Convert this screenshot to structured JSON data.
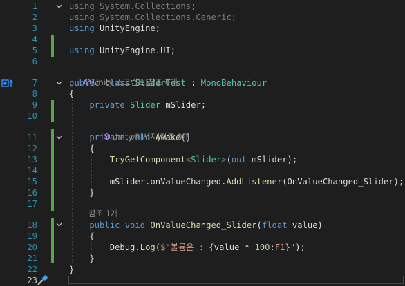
{
  "editor": {
    "lines": [
      {
        "n": "1",
        "tokens": [
          {
            "t": "using ",
            "c": "dim"
          },
          {
            "t": "System.Collections;",
            "c": "dim"
          }
        ]
      },
      {
        "n": "2",
        "tokens": [
          {
            "t": "using ",
            "c": "dim"
          },
          {
            "t": "System.Collections.Generic;",
            "c": "dim"
          }
        ]
      },
      {
        "n": "3",
        "tokens": [
          {
            "t": "using ",
            "c": "kw"
          },
          {
            "t": "UnityEngine;",
            "c": "pl"
          }
        ]
      },
      {
        "n": "4",
        "tokens": []
      },
      {
        "n": "5",
        "tokens": [
          {
            "t": "using ",
            "c": "kw"
          },
          {
            "t": "UnityEngine.UI;",
            "c": "pl"
          }
        ]
      },
      {
        "n": "6",
        "tokens": []
      },
      {
        "n": "7",
        "tokens": [
          {
            "t": "public ",
            "c": "kw"
          },
          {
            "t": "class ",
            "c": "kw"
          },
          {
            "t": "SliderTest",
            "c": "ty"
          },
          {
            "t": " : ",
            "c": "pl"
          },
          {
            "t": "MonoBehaviour",
            "c": "ty"
          }
        ]
      },
      {
        "n": "8",
        "tokens": [
          {
            "t": "{",
            "c": "pl"
          }
        ]
      },
      {
        "n": "9",
        "tokens": [
          {
            "t": "    private ",
            "c": "kw"
          },
          {
            "t": "Slider",
            "c": "ty"
          },
          {
            "t": " mSlider;",
            "c": "pl"
          }
        ]
      },
      {
        "n": "10",
        "tokens": []
      },
      {
        "n": "11",
        "tokens": [
          {
            "t": "    private ",
            "c": "kw"
          },
          {
            "t": "void ",
            "c": "kw"
          },
          {
            "t": "Awake",
            "c": "mt"
          },
          {
            "t": "()",
            "c": "pl"
          }
        ]
      },
      {
        "n": "12",
        "tokens": [
          {
            "t": "    {",
            "c": "pl"
          }
        ]
      },
      {
        "n": "13",
        "tokens": [
          {
            "t": "        TryGetComponent",
            "c": "mt"
          },
          {
            "t": "<",
            "c": "dim"
          },
          {
            "t": "Slider",
            "c": "ty"
          },
          {
            "t": ">",
            "c": "dim"
          },
          {
            "t": "(",
            "c": "pl"
          },
          {
            "t": "out",
            "c": "kw"
          },
          {
            "t": " mSlider);",
            "c": "pl"
          }
        ]
      },
      {
        "n": "14",
        "tokens": []
      },
      {
        "n": "15",
        "tokens": [
          {
            "t": "        mSlider.onValueChanged.",
            "c": "pl"
          },
          {
            "t": "AddListener",
            "c": "mt"
          },
          {
            "t": "(OnValueChanged_Slider);",
            "c": "pl"
          }
        ]
      },
      {
        "n": "16",
        "tokens": [
          {
            "t": "    }",
            "c": "pl"
          }
        ]
      },
      {
        "n": "17",
        "tokens": []
      },
      {
        "n": "18",
        "tokens": [
          {
            "t": "    public ",
            "c": "kw"
          },
          {
            "t": "void ",
            "c": "kw"
          },
          {
            "t": "OnValueChanged_Slider",
            "c": "mt"
          },
          {
            "t": "(",
            "c": "pl"
          },
          {
            "t": "float",
            "c": "kw"
          },
          {
            "t": " value)",
            "c": "pl"
          }
        ]
      },
      {
        "n": "19",
        "tokens": [
          {
            "t": "    {",
            "c": "pl"
          }
        ]
      },
      {
        "n": "20",
        "tokens": [
          {
            "t": "        Debug.",
            "c": "pl"
          },
          {
            "t": "Log",
            "c": "mt"
          },
          {
            "t": "(",
            "c": "pl"
          },
          {
            "t": "$\"볼륨은 : ",
            "c": "st"
          },
          {
            "t": "{value * ",
            "c": "pl"
          },
          {
            "t": "100",
            "c": "nu"
          },
          {
            "t": ":",
            "c": "pl"
          },
          {
            "t": "F1",
            "c": "st"
          },
          {
            "t": "}",
            "c": "pl"
          },
          {
            "t": "\"",
            "c": "st"
          },
          {
            "t": ");",
            "c": "pl"
          }
        ]
      },
      {
        "n": "21",
        "tokens": [
          {
            "t": "    }",
            "c": "pl"
          }
        ]
      },
      {
        "n": "22",
        "tokens": [
          {
            "t": "}",
            "c": "pl"
          }
        ]
      },
      {
        "n": "23",
        "tokens": []
      }
    ],
    "codelens": [
      {
        "text": "Unity 스크립트|참조 0개",
        "icon": "unity-cube-icon"
      },
      {
        "text": "Unity 메시지|참조 0개",
        "icon": "unity-cube-icon"
      },
      {
        "text": "참조 1개",
        "icon": ""
      }
    ],
    "current_line": "23",
    "colors": {
      "background": "#1e1e1e",
      "line_number": "#2b91af",
      "keyword": "#569cd6",
      "type": "#4ec9b0",
      "method": "#dcdcaa",
      "string": "#d69d85",
      "number": "#b5cea8",
      "change_bar": "#57a64a"
    }
  }
}
